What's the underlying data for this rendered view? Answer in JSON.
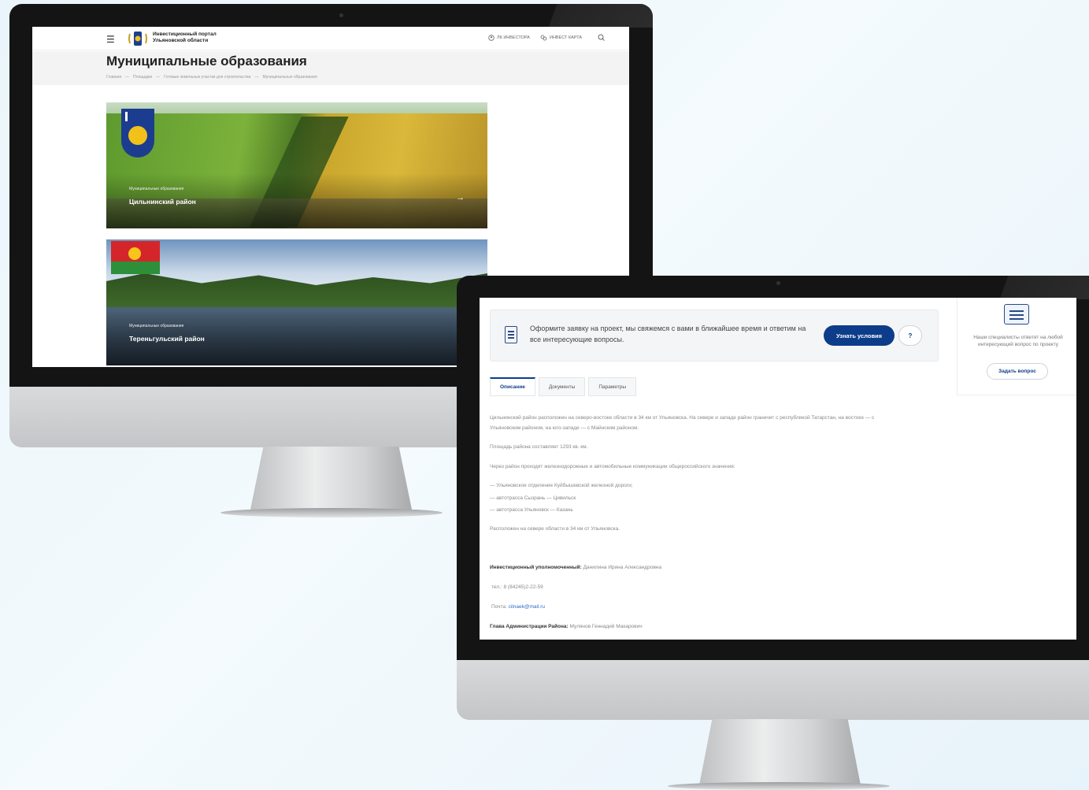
{
  "portal": {
    "logo_text": "Инвестиционный портал Ульяновской области",
    "nav_investor": "ЛК ИНВЕСТОРА",
    "nav_map": "ИНВЕСТ КАРТА"
  },
  "municipal_page": {
    "title": "Муниципальные образования",
    "breadcrumbs": [
      "Главная",
      "Площадки",
      "Готовые земельные участки для строительства",
      "Муниципальные образования"
    ],
    "cards": [
      {
        "category": "Муниципальные образования",
        "name": "Цильнинский район"
      },
      {
        "category": "Муниципальные образования",
        "name": "Тереньгульский район"
      }
    ]
  },
  "district_page": {
    "apply_text": "Оформите заявку на проект, мы свяжемся с вами в ближайшее время и ответим на все интересующие вопросы.",
    "apply_button": "Узнать условия",
    "help_button": "?",
    "side_text": "Наши специалисты ответят на любой интересующий вопрос по проекту",
    "ask_button": "Задать вопрос",
    "tabs": [
      "Описание",
      "Документы",
      "Параметры"
    ],
    "p1": "Цильнинский район расположен на северо-востоке области в 34 км от Ульяновска. На севере и западе район граничит с республикой Татарстан, на востоке — с Ульяновским районом, на юго-западе — с Майнским районом.",
    "p2": "Площадь района составляет 1293 кв. км.",
    "p3": "Через район проходят железнодорожные и автомобильные коммуникации общероссийского значения:",
    "list": [
      "— Ульяновское отделение Куйбышевской железной дороги;",
      "— автотрасса Сызрань — Цивильск",
      "— автотрасса Ульяновск — Казань"
    ],
    "p4": "Расположен на севере области в 34 км от Ульяновска.",
    "rep_label": "Инвестиционный уполномоченный:",
    "rep_name": "Данилина Ирина Александровна",
    "phone": "тел.: 8 (84245)2-22-59",
    "email_label": "Почта:",
    "email": "cilnaek@mail.ru",
    "head_label": "Глава Администрации Района:",
    "head_name": "Мулянов Геннадий Макарович"
  }
}
